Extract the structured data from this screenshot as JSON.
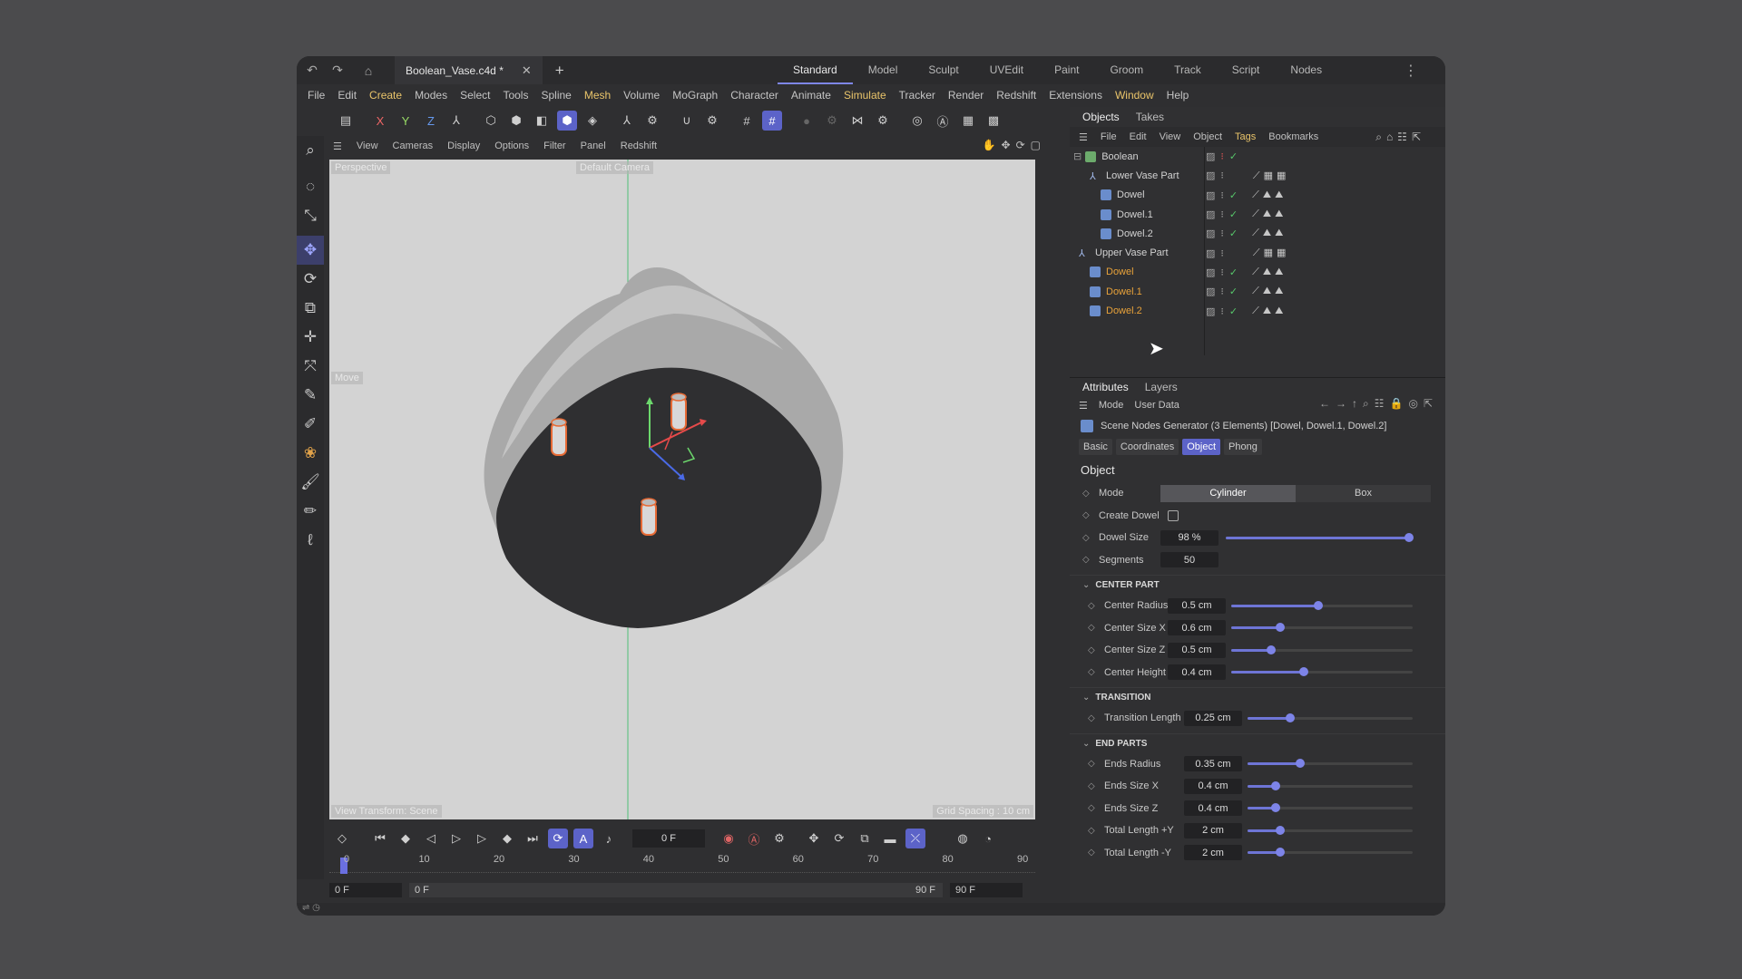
{
  "window": {
    "doc_tab": "Boolean_Vase.c4d *",
    "layouts": [
      "Standard",
      "Model",
      "Sculpt",
      "UVEdit",
      "Paint",
      "Groom",
      "Track",
      "Script",
      "Nodes"
    ],
    "active_layout": "Standard"
  },
  "menubar": [
    "File",
    "Edit",
    "Create",
    "Modes",
    "Select",
    "Tools",
    "Spline",
    "Mesh",
    "Volume",
    "MoGraph",
    "Character",
    "Animate",
    "Simulate",
    "Tracker",
    "Render",
    "Redshift",
    "Extensions",
    "Window",
    "Help"
  ],
  "viewport": {
    "menu": [
      "View",
      "Cameras",
      "Display",
      "Options",
      "Filter",
      "Panel",
      "Redshift"
    ],
    "label_tl": "Perspective",
    "label_top": "Default Camera",
    "label_left": "Move",
    "label_bl": "View Transform: Scene",
    "label_br": "Grid Spacing : 10 cm"
  },
  "objects_panel": {
    "tabs": [
      "Objects",
      "Takes"
    ],
    "menu": [
      "File",
      "Edit",
      "View",
      "Object",
      "Tags",
      "Bookmarks"
    ],
    "rows": [
      {
        "name": "Boolean",
        "indent": 0,
        "orange": false
      },
      {
        "name": "Lower Vase Part",
        "indent": 1,
        "orange": false
      },
      {
        "name": "Dowel",
        "indent": 2,
        "orange": false
      },
      {
        "name": "Dowel.1",
        "indent": 2,
        "orange": false
      },
      {
        "name": "Dowel.2",
        "indent": 2,
        "orange": false
      },
      {
        "name": "Upper Vase Part",
        "indent": 1,
        "orange": false
      },
      {
        "name": "Dowel",
        "indent": 2,
        "orange": true
      },
      {
        "name": "Dowel.1",
        "indent": 2,
        "orange": true
      },
      {
        "name": "Dowel.2",
        "indent": 2,
        "orange": true
      }
    ]
  },
  "attributes": {
    "tabs": [
      "Attributes",
      "Layers"
    ],
    "mode_menu": [
      "Mode",
      "User Data"
    ],
    "generator_title": "Scene Nodes Generator (3 Elements) [Dowel, Dowel.1, Dowel.2]",
    "subtabs": [
      "Basic",
      "Coordinates",
      "Object",
      "Phong"
    ],
    "active_subtab": "Object",
    "section": "Object",
    "mode": {
      "label": "Mode",
      "options": [
        "Cylinder",
        "Box"
      ],
      "selected": "Cylinder"
    },
    "create_dowel": {
      "label": "Create Dowel",
      "checked": false
    },
    "dowel_size": {
      "label": "Dowel Size",
      "value": "98 %",
      "level": 0.98
    },
    "segments": {
      "label": "Segments",
      "value": "50"
    },
    "center_part": {
      "title": "CENTER PART",
      "params": [
        {
          "label": "Center Radius",
          "value": "0.5 cm",
          "level": 0.48
        },
        {
          "label": "Center Size X",
          "value": "0.6 cm",
          "level": 0.27
        },
        {
          "label": "Center Size Z",
          "value": "0.5 cm",
          "level": 0.22
        },
        {
          "label": "Center Height",
          "value": "0.4 cm",
          "level": 0.4
        }
      ]
    },
    "transition": {
      "title": "TRANSITION",
      "params": [
        {
          "label": "Transition Length",
          "value": "0.25 cm",
          "level": 0.26
        }
      ]
    },
    "end_parts": {
      "title": "END PARTS",
      "params": [
        {
          "label": "Ends Radius",
          "value": "0.35 cm",
          "level": 0.32
        },
        {
          "label": "Ends Size X",
          "value": "0.4 cm",
          "level": 0.17
        },
        {
          "label": "Ends Size Z",
          "value": "0.4 cm",
          "level": 0.17
        },
        {
          "label": "Total Length +Y",
          "value": "2 cm",
          "level": 0.2
        },
        {
          "label": "Total Length -Y",
          "value": "2 cm",
          "level": 0.2
        }
      ]
    }
  },
  "timeline": {
    "current_frame": "0 F",
    "ticks": [
      "0",
      "10",
      "20",
      "30",
      "40",
      "50",
      "60",
      "70",
      "80",
      "90"
    ],
    "range_start": "0 F",
    "range_min": "0 F",
    "range_max": "90 F",
    "range_end": "90 F"
  },
  "colors": {
    "accent": "#5c63c8",
    "orange": "#e8a23a",
    "check": "#57c66a"
  }
}
